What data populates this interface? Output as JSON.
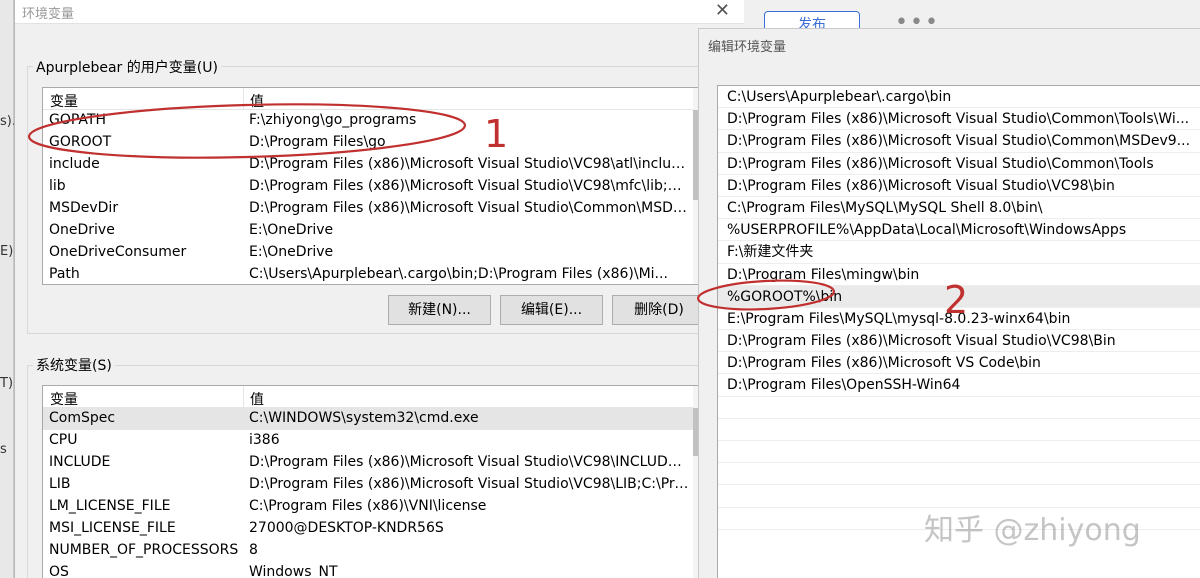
{
  "background_app": {
    "fragments": [
      "s).",
      "E).",
      "T).",
      "s"
    ],
    "publish_label": "发布",
    "more_label": "•••"
  },
  "env_dialog": {
    "title": "环境变量",
    "close_icon": "close-icon",
    "user_group_label": "Apurplebear 的用户变量(U)",
    "system_group_label": "系统变量(S)",
    "col_variable": "变量",
    "col_value": "值",
    "user_vars": [
      {
        "name": "GOPATH",
        "value": "F:\\zhiyong\\go_programs"
      },
      {
        "name": "GOROOT",
        "value": "D:\\Program Files\\go"
      },
      {
        "name": "include",
        "value": "D:\\Program Files (x86)\\Microsoft Visual Studio\\VC98\\atl\\include..."
      },
      {
        "name": "lib",
        "value": "D:\\Program Files (x86)\\Microsoft Visual Studio\\VC98\\mfc\\lib;D:\\..."
      },
      {
        "name": "MSDevDir",
        "value": "D:\\Program Files (x86)\\Microsoft Visual Studio\\Common\\MSDe..."
      },
      {
        "name": "OneDrive",
        "value": "E:\\OneDrive"
      },
      {
        "name": "OneDriveConsumer",
        "value": "E:\\OneDrive"
      },
      {
        "name": "Path",
        "value": "C:\\Users\\Apurplebear\\.cargo\\bin;D:\\Program Files (x86)\\Mi..."
      }
    ],
    "buttons": {
      "new": "新建(N)...",
      "edit": "编辑(E)...",
      "delete": "删除(D)"
    },
    "system_vars": [
      {
        "name": "ComSpec",
        "value": "C:\\WINDOWS\\system32\\cmd.exe"
      },
      {
        "name": "CPU",
        "value": "i386"
      },
      {
        "name": "INCLUDE",
        "value": "D:\\Program Files (x86)\\Microsoft Visual Studio\\VC98\\INCLUDE;C..."
      },
      {
        "name": "LIB",
        "value": "D:\\Program Files (x86)\\Microsoft Visual Studio\\VC98\\LIB;C:\\Pro..."
      },
      {
        "name": "LM_LICENSE_FILE",
        "value": "C:\\Program Files (x86)\\VNI\\license"
      },
      {
        "name": "MSI_LICENSE_FILE",
        "value": "27000@DESKTOP-KNDR56S"
      },
      {
        "name": "NUMBER_OF_PROCESSORS",
        "value": "8"
      },
      {
        "name": "OS",
        "value": "Windows_NT"
      }
    ]
  },
  "edit_dialog": {
    "title": "编辑环境变量",
    "entries": [
      "C:\\Users\\Apurplebear\\.cargo\\bin",
      "D:\\Program Files (x86)\\Microsoft Visual Studio\\Common\\Tools\\Wi...",
      "D:\\Program Files (x86)\\Microsoft Visual Studio\\Common\\MSDev9...",
      "D:\\Program Files (x86)\\Microsoft Visual Studio\\Common\\Tools",
      "D:\\Program Files (x86)\\Microsoft Visual Studio\\VC98\\bin",
      "C:\\Program Files\\MySQL\\MySQL Shell 8.0\\bin\\",
      "%USERPROFILE%\\AppData\\Local\\Microsoft\\WindowsApps",
      "F:\\新建文件夹",
      "D:\\Program Files\\mingw\\bin",
      "%GOROOT%\\bin",
      "E:\\Program Files\\MySQL\\mysql-8.0.23-winx64\\bin",
      "D:\\Program Files (x86)\\Microsoft Visual Studio\\VC98\\Bin",
      "D:\\Program Files (x86)\\Microsoft VS Code\\bin",
      "D:\\Program Files\\OpenSSH-Win64",
      "",
      "",
      "",
      "",
      "",
      ""
    ],
    "selected_index": 9
  },
  "annotations": {
    "one": "1",
    "two": "2"
  },
  "watermark": "知乎 @zhiyong",
  "colors": {
    "annotation": "#c0302f",
    "selection": "#e5e5e5",
    "accent": "#3a6ed6"
  }
}
